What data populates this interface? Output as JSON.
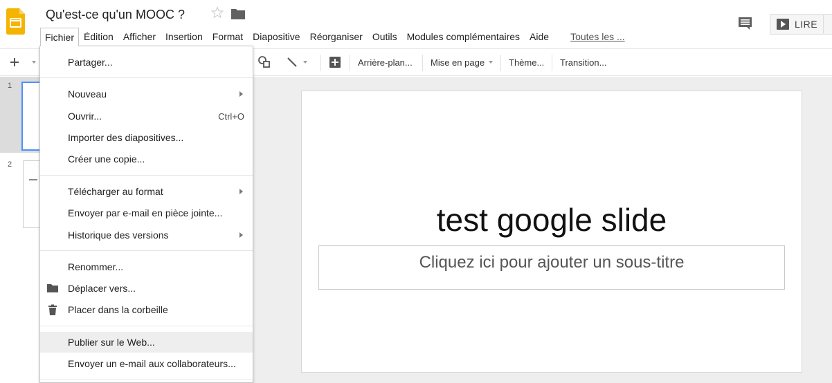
{
  "header": {
    "title": "Qu'est-ce qu'un MOOC ?",
    "menu": [
      "Fichier",
      "Édition",
      "Afficher",
      "Insertion",
      "Format",
      "Diapositive",
      "Réorganiser",
      "Outils",
      "Modules complémentaires",
      "Aide"
    ],
    "changes_link": "Toutes les ...",
    "present_label": "LIRE"
  },
  "toolbar": {
    "background": "Arrière-plan...",
    "layout": "Mise en page",
    "theme": "Thème...",
    "transition": "Transition..."
  },
  "filmstrip": {
    "slides": [
      "1",
      "2"
    ]
  },
  "slide": {
    "title": "test google slide",
    "subtitle_placeholder": "Cliquez ici pour ajouter un sous-titre"
  },
  "file_menu": {
    "share": "Partager...",
    "new": "Nouveau",
    "open": "Ouvrir...",
    "open_shortcut": "Ctrl+O",
    "import": "Importer des diapositives...",
    "copy": "Créer une copie...",
    "download": "Télécharger au format",
    "email_attachment": "Envoyer par e-mail en pièce jointe...",
    "version_history": "Historique des versions",
    "rename": "Renommer...",
    "move": "Déplacer vers...",
    "trash": "Placer dans la corbeille",
    "publish": "Publier sur le Web...",
    "email_collaborators": "Envoyer un e-mail aux collaborateurs..."
  },
  "colors": {
    "accent_blue": "#4d90fe",
    "logo_yellow": "#f4b400",
    "menu_highlight": "#eeeeee",
    "canvas_bg": "#eeeeee"
  }
}
